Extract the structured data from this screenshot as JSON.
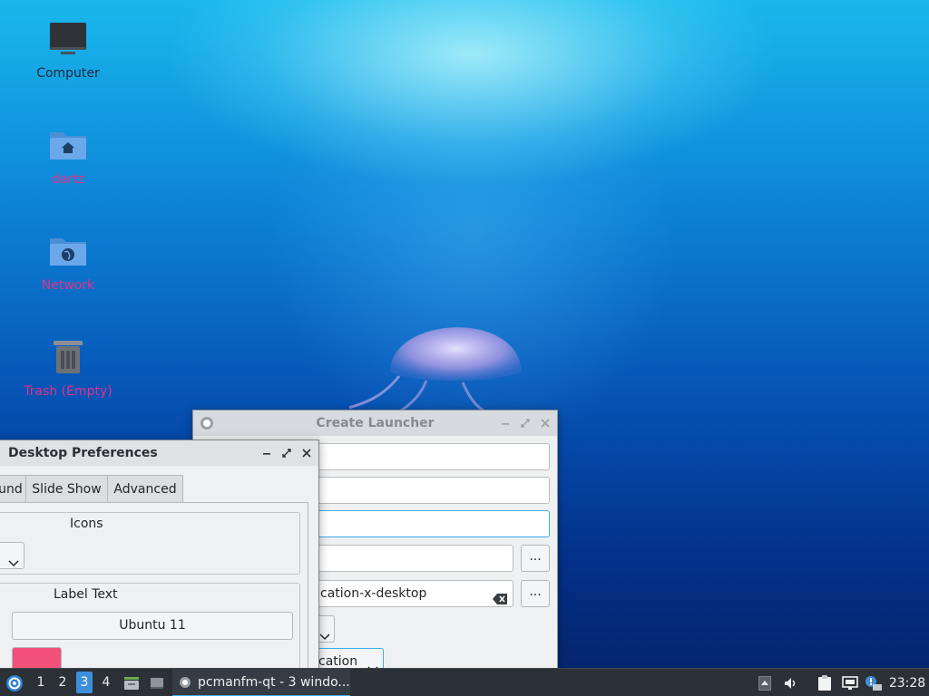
{
  "desktop": {
    "icons": [
      {
        "label": "Computer"
      },
      {
        "label": "dartz"
      },
      {
        "label": "Network"
      },
      {
        "label": "Trash (Empty)"
      }
    ]
  },
  "launcher_window": {
    "title": "Create Launcher",
    "fields": {
      "icon_value": "cation-x-desktop",
      "browse_label": "...",
      "combo_visible_text": "cation"
    }
  },
  "prefs_window": {
    "title": "Desktop Preferences",
    "tabs": [
      {
        "label": "und"
      },
      {
        "label": "Slide Show"
      },
      {
        "label": "Advanced"
      }
    ],
    "groups": {
      "icons_title": "Icons",
      "label_text_title": "Label Text",
      "font_button": "Ubuntu 11",
      "text_color": "#f0507a"
    }
  },
  "taskbar": {
    "desktops": [
      "1",
      "2",
      "3",
      "4"
    ],
    "active_desktop": "3",
    "task_label": "pcmanfm-qt - 3 windo...",
    "clock": "23:28"
  }
}
